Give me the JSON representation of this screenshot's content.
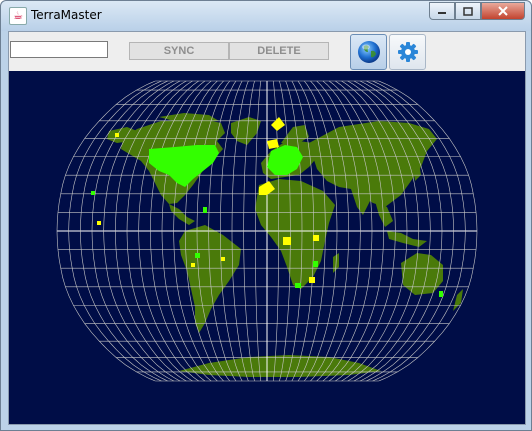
{
  "window": {
    "title": "TerraMaster",
    "controls": {
      "minimize": "minimize-icon",
      "maximize": "maximize-icon",
      "close": "close-icon"
    }
  },
  "toolbar": {
    "search_value": "",
    "sync_label": "SYNC",
    "delete_label": "DELETE",
    "globe_icon": "globe-icon",
    "settings_icon": "gear-icon"
  },
  "map": {
    "projection": "Robinson",
    "colors": {
      "ocean": "#000d47",
      "land": "#4a7a0a",
      "grid": "#c8c8c8",
      "equator_meridian": "#ffffff",
      "synced_tiles": "#33ff00",
      "selected_tiles": "#ffff00"
    }
  }
}
